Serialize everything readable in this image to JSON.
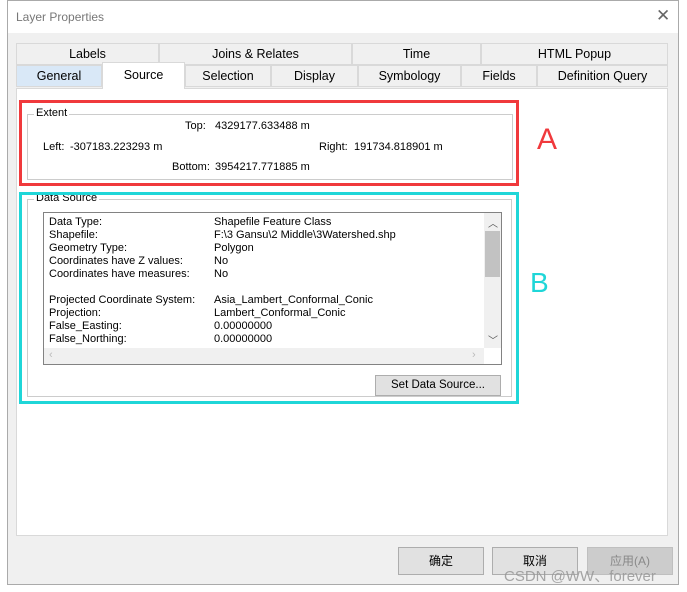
{
  "window": {
    "title": "Layer Properties",
    "close_icon": "close-icon"
  },
  "tabs": {
    "row1": [
      "Labels",
      "Joins & Relates",
      "Time",
      "HTML Popup"
    ],
    "row2": [
      "General",
      "Source",
      "Selection",
      "Display",
      "Symbology",
      "Fields",
      "Definition Query"
    ],
    "active": "Source"
  },
  "extent": {
    "label": "Extent",
    "top_label": "Top:",
    "top": "4329177.633488 m",
    "left_label": "Left:",
    "left": "-307183.223293 m",
    "right_label": "Right:",
    "right": "191734.818901 m",
    "bottom_label": "Bottom:",
    "bottom": "3954217.771885 m"
  },
  "data_source": {
    "label": "Data Source",
    "rows": [
      {
        "k": "Data Type:",
        "v": "Shapefile Feature Class"
      },
      {
        "k": "Shapefile:",
        "v": "F:\\3 Gansu\\2 Middle\\3Watershed.shp"
      },
      {
        "k": "Geometry Type:",
        "v": "Polygon"
      },
      {
        "k": "Coordinates have Z values:",
        "v": "No"
      },
      {
        "k": "Coordinates have measures:",
        "v": "No"
      },
      {
        "k": "",
        "v": ""
      },
      {
        "k": "Projected Coordinate System:",
        "v": "Asia_Lambert_Conformal_Conic"
      },
      {
        "k": "Projection:",
        "v": "Lambert_Conformal_Conic"
      },
      {
        "k": "False_Easting:",
        "v": "0.00000000"
      },
      {
        "k": "False_Northing:",
        "v": "0.00000000"
      }
    ],
    "set_button": "Set Data Source..."
  },
  "annotations": {
    "a": "A",
    "b": "B",
    "a_color": "#f0393c",
    "b_color": "#1fd6d8"
  },
  "buttons": {
    "ok": "确定",
    "cancel": "取消",
    "apply": "应用(A)"
  },
  "watermark": "CSDN @WW、forever"
}
